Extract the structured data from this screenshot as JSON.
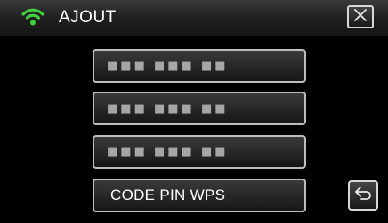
{
  "header": {
    "title": "AJOUT",
    "wifi_icon": "wifi-icon",
    "wifi_color": "#3fcf3f",
    "close_icon": "close-icon"
  },
  "menu": {
    "items": [
      {
        "label": "■■■ ■■■ ■■"
      },
      {
        "label": "■■■ ■■■ ■■"
      },
      {
        "label": "■■■ ■■■ ■■"
      },
      {
        "label": "CODE PIN WPS"
      }
    ]
  },
  "footer": {
    "back_icon": "return-icon"
  }
}
